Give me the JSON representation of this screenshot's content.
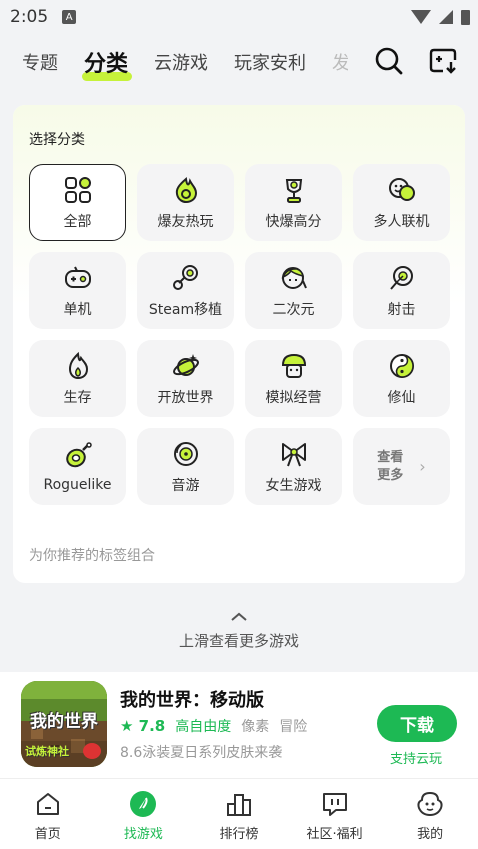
{
  "status": {
    "time": "2:05",
    "badge": "A"
  },
  "top_nav": {
    "tabs": [
      {
        "label": "专题"
      },
      {
        "label": "分类"
      },
      {
        "label": "云游戏"
      },
      {
        "label": "玩家安利"
      },
      {
        "label": "发"
      }
    ],
    "active_index": 1
  },
  "category_panel": {
    "title": "选择分类",
    "items": [
      {
        "label": "全部",
        "icon": "grid-icon"
      },
      {
        "label": "爆友热玩",
        "icon": "fire-icon"
      },
      {
        "label": "快爆高分",
        "icon": "trophy-icon"
      },
      {
        "label": "多人联机",
        "icon": "multiplayer-icon"
      },
      {
        "label": "单机",
        "icon": "gamepad-icon"
      },
      {
        "label": "Steam移植",
        "icon": "steam-icon"
      },
      {
        "label": "二次元",
        "icon": "anime-icon"
      },
      {
        "label": "射击",
        "icon": "target-icon"
      },
      {
        "label": "生存",
        "icon": "flame-icon"
      },
      {
        "label": "开放世界",
        "icon": "planet-icon"
      },
      {
        "label": "模拟经营",
        "icon": "mushroom-icon"
      },
      {
        "label": "修仙",
        "icon": "yin-yang-icon"
      },
      {
        "label": "Roguelike",
        "icon": "meat-icon"
      },
      {
        "label": "音游",
        "icon": "music-disc-icon"
      },
      {
        "label": "女生游戏",
        "icon": "bow-icon"
      }
    ],
    "more_label_1": "查看",
    "more_label_2": "更多",
    "more_arrow": "›",
    "recommend_label": "为你推荐的标签组合"
  },
  "swipe_hint": "上滑查看更多游戏",
  "game": {
    "title": "我的世界：移动版",
    "score": "★ 7.8",
    "tags": [
      "高自由度",
      "像素",
      "冒险"
    ],
    "description": "8.6泳装夏日系列皮肤来袭",
    "download_label": "下载",
    "cloud_label": "支持云玩",
    "icon_text": "我的世界",
    "icon_subtext": "试炼神社"
  },
  "bottom_tabs": [
    {
      "label": "首页",
      "icon": "home-icon"
    },
    {
      "label": "找游戏",
      "icon": "compass-icon"
    },
    {
      "label": "排行榜",
      "icon": "ranking-icon"
    },
    {
      "label": "社区·福利",
      "icon": "community-icon"
    },
    {
      "label": "我的",
      "icon": "profile-icon"
    }
  ],
  "colors": {
    "accent": "#1db954",
    "highlight": "#c6f23a"
  }
}
